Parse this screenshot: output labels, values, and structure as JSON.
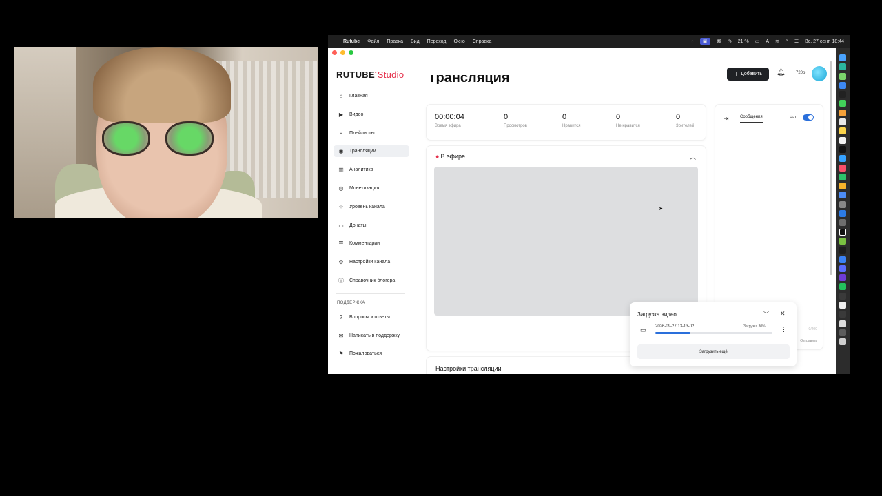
{
  "menubar": {
    "app_name": "Rutube",
    "items": [
      "Файл",
      "Правка",
      "Вид",
      "Переход",
      "Окно",
      "Справка"
    ],
    "battery": "21 %",
    "clock": "Вс, 27 сент. 18:44"
  },
  "header": {
    "logo_main": "RUTUBE",
    "logo_studio": "Studio",
    "add_button": "Добавить",
    "quality": "720p"
  },
  "sidebar": {
    "items": [
      {
        "label": "Главная",
        "icon": "home-icon",
        "glyph": "⌂"
      },
      {
        "label": "Видео",
        "icon": "video-icon",
        "glyph": "▶"
      },
      {
        "label": "Плейлисты",
        "icon": "playlist-icon",
        "glyph": "≡"
      },
      {
        "label": "Трансляции",
        "icon": "broadcast-icon",
        "glyph": "◉"
      },
      {
        "label": "Аналитика",
        "icon": "analytics-icon",
        "glyph": "▥"
      },
      {
        "label": "Монетизация",
        "icon": "money-icon",
        "glyph": "◎"
      },
      {
        "label": "Уровень канала",
        "icon": "star-icon",
        "glyph": "☆"
      },
      {
        "label": "Донаты",
        "icon": "donate-icon",
        "glyph": "▭"
      },
      {
        "label": "Комментарии",
        "icon": "comments-icon",
        "glyph": "☰"
      },
      {
        "label": "Настройки канала",
        "icon": "gear-icon",
        "glyph": "⚙"
      },
      {
        "label": "Справочник блогера",
        "icon": "info-icon",
        "glyph": "ⓘ"
      }
    ],
    "support_label": "ПОДДЕРЖКА",
    "support_items": [
      {
        "label": "Вопросы и ответы",
        "icon": "help-icon",
        "glyph": "?"
      },
      {
        "label": "Написать в поддержку",
        "icon": "mail-icon",
        "glyph": "✉"
      },
      {
        "label": "Пожаловаться",
        "icon": "flag-icon",
        "glyph": "⚑"
      }
    ]
  },
  "main": {
    "page_title": "Трансляция",
    "stats": [
      {
        "value": "00:00:04",
        "label": "Время эфира"
      },
      {
        "value": "0",
        "label": "Просмотров"
      },
      {
        "value": "0",
        "label": "Нравится"
      },
      {
        "value": "0",
        "label": "Не нравится"
      },
      {
        "value": "0",
        "label": "Зрителей"
      }
    ],
    "live_title": "В эфире",
    "settings_title": "Настройки трансляции"
  },
  "chat": {
    "tab_label": "Сообщения",
    "toggle_label": "Чат",
    "toggle_on": true,
    "char_count": "0/200",
    "send_label": "Отправить"
  },
  "upload": {
    "title": "Загрузка видео",
    "file_name": "2026-09-27 13-13-02",
    "status": "Загрузка 30%",
    "progress": 30,
    "more_button": "Загрузить ещё"
  },
  "colors": {
    "accent": "#e5304b",
    "primary": "#2a6fdb",
    "dark_button": "#1f2125"
  }
}
